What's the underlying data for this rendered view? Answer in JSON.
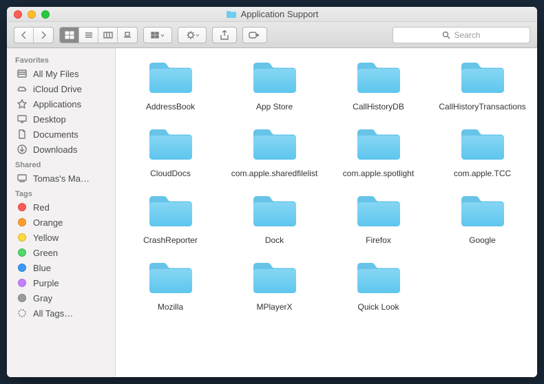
{
  "window": {
    "title": "Application Support"
  },
  "search": {
    "placeholder": "Search"
  },
  "sidebar": {
    "sections": [
      {
        "header": "Favorites",
        "items": [
          {
            "label": "All My Files",
            "icon": "all-my-files"
          },
          {
            "label": "iCloud Drive",
            "icon": "icloud"
          },
          {
            "label": "Applications",
            "icon": "applications"
          },
          {
            "label": "Desktop",
            "icon": "desktop"
          },
          {
            "label": "Documents",
            "icon": "documents"
          },
          {
            "label": "Downloads",
            "icon": "downloads"
          }
        ]
      },
      {
        "header": "Shared",
        "items": [
          {
            "label": "Tomas's Ma…",
            "icon": "computer"
          }
        ]
      },
      {
        "header": "Tags",
        "items": [
          {
            "label": "Red",
            "icon": "tag",
            "color": "#ff5b56"
          },
          {
            "label": "Orange",
            "icon": "tag",
            "color": "#ff9e2c"
          },
          {
            "label": "Yellow",
            "icon": "tag",
            "color": "#ffd93a"
          },
          {
            "label": "Green",
            "icon": "tag",
            "color": "#53d86a"
          },
          {
            "label": "Blue",
            "icon": "tag",
            "color": "#3a98f8"
          },
          {
            "label": "Purple",
            "icon": "tag",
            "color": "#c680ff"
          },
          {
            "label": "Gray",
            "icon": "tag",
            "color": "#9b9b9b"
          },
          {
            "label": "All Tags…",
            "icon": "alltags"
          }
        ]
      }
    ]
  },
  "folders": [
    {
      "name": "AddressBook"
    },
    {
      "name": "App Store"
    },
    {
      "name": "CallHistoryDB"
    },
    {
      "name": "CallHistoryTransactions"
    },
    {
      "name": "CloudDocs"
    },
    {
      "name": "com.apple.sharedfilelist"
    },
    {
      "name": "com.apple.spotlight"
    },
    {
      "name": "com.apple.TCC"
    },
    {
      "name": "CrashReporter"
    },
    {
      "name": "Dock"
    },
    {
      "name": "Firefox"
    },
    {
      "name": "Google"
    },
    {
      "name": "Mozilla"
    },
    {
      "name": "MPlayerX"
    },
    {
      "name": "Quick Look"
    }
  ],
  "colors": {
    "folder_light": "#86d6f3",
    "folder_dark": "#5ec6ee",
    "folder_tab": "#67c4e8"
  }
}
